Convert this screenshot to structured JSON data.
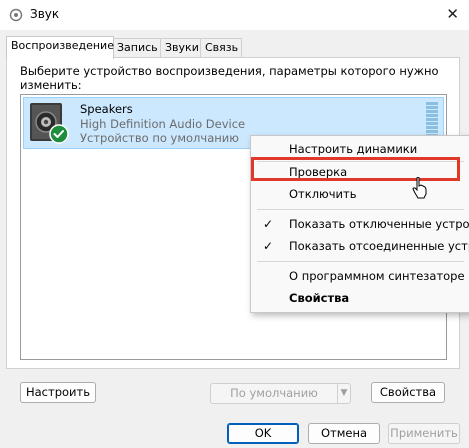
{
  "window": {
    "title": "Звук",
    "close_glyph": "✕"
  },
  "tabs": [
    {
      "label": "Воспроизведение",
      "active": true
    },
    {
      "label": "Запись",
      "active": false
    },
    {
      "label": "Звуки",
      "active": false
    },
    {
      "label": "Связь",
      "active": false
    }
  ],
  "instruction": "Выберите устройство воспроизведения, параметры которого нужно изменить:",
  "device": {
    "name": "Speakers",
    "description": "High Definition Audio Device",
    "status": "Устройство по умолчанию",
    "icon": "speaker-icon",
    "status_icon": "check-badge-icon"
  },
  "context_menu": {
    "items": [
      {
        "label": "Настроить динамики"
      },
      {
        "label": "Проверка",
        "highlighted": true
      },
      {
        "label": "Отключить"
      },
      {
        "label": "Показать отключенные устройства",
        "checked": true
      },
      {
        "label": "Показать отсоединенные устройства",
        "checked": true
      },
      {
        "label": "О программном синтезаторе MIDI"
      },
      {
        "label": "Свойства",
        "bold": true
      }
    ],
    "check_glyph": "✓",
    "highlight_color": "#e0392b"
  },
  "buttons": {
    "configure": "Настроить",
    "set_default": "По умолчанию",
    "properties": "Свойства",
    "ok": "OK",
    "cancel": "Отмена",
    "apply": "Применить"
  },
  "colors": {
    "selection_bg": "#cce8ff",
    "selection_border": "#99d1ff",
    "accent": "#005fb8",
    "check_green": "#1e8e3e"
  }
}
